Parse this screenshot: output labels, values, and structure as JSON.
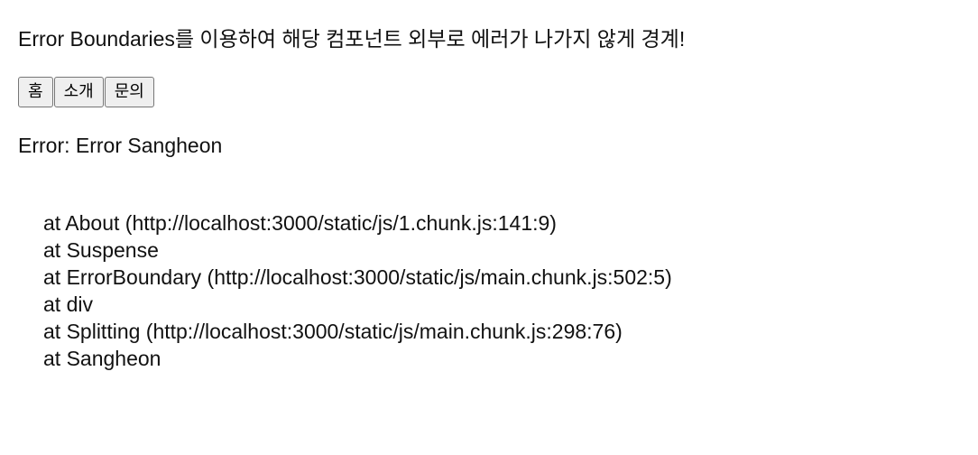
{
  "headline": "Error Boundaries를 이용하여 해당 컴포넌트 외부로 에러가 나가지 않게 경계!",
  "nav": {
    "buttons": [
      "홈",
      "소개",
      "문의"
    ]
  },
  "error": {
    "title": "Error: Error Sangheon",
    "stack": [
      "at About (http://localhost:3000/static/js/1.chunk.js:141:9)",
      "at Suspense",
      "at ErrorBoundary (http://localhost:3000/static/js/main.chunk.js:502:5)",
      "at div",
      "at Splitting (http://localhost:3000/static/js/main.chunk.js:298:76)",
      "at Sangheon"
    ]
  }
}
